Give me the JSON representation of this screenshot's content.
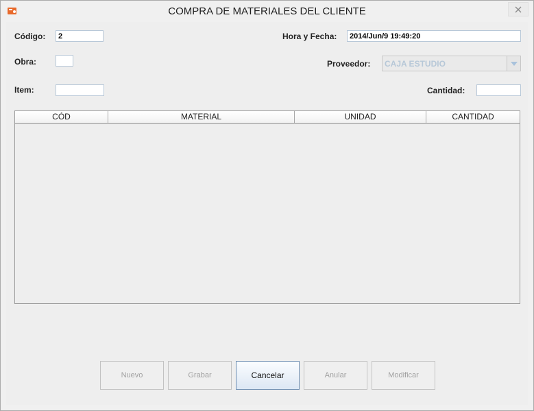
{
  "window": {
    "title": "COMPRA DE MATERIALES DEL CLIENTE"
  },
  "form": {
    "codigo_label": "Código:",
    "codigo_value": "2",
    "hora_fecha_label": "Hora y Fecha:",
    "hora_fecha_value": "2014/Jun/9 19:49:20",
    "obra_label": "Obra:",
    "obra_value": "",
    "proveedor_label": "Proveedor:",
    "proveedor_value": "CAJA ESTUDIO",
    "item_label": "Item:",
    "item_value": "",
    "cantidad_label": "Cantidad:",
    "cantidad_value": ""
  },
  "table": {
    "columns": [
      "CÓD",
      "MATERIAL",
      "UNIDAD",
      "CANTIDAD"
    ],
    "rows": []
  },
  "buttons": {
    "nuevo": "Nuevo",
    "grabar": "Grabar",
    "cancelar": "Cancelar",
    "anular": "Anular",
    "modificar": "Modificar"
  },
  "colors": {
    "accent": "#6f8fb2",
    "disabled_text": "#9f9f9f",
    "app_icon": "#e8692a"
  }
}
